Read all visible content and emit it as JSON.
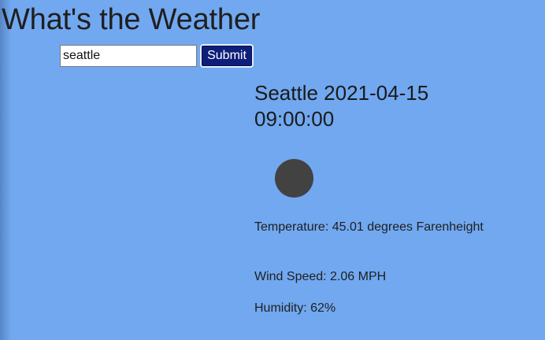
{
  "page": {
    "title": "What's the Weather"
  },
  "search": {
    "value": "seattle",
    "submit_label": "Submit"
  },
  "weather": {
    "city": "Seattle",
    "datetime": "2021-04-15 09:00:00",
    "heading": "Seattle 2021-04-15 09:00:00",
    "icon": "circle-weather-icon",
    "temperature_text": "Temperature: 45.01 degrees Farenheight",
    "wind_text": "Wind Speed: 2.06 MPH",
    "humidity_text": "Humidity: 62%"
  },
  "colors": {
    "background": "#71a8f0",
    "button": "#0d1f7a",
    "icon": "#424242"
  }
}
